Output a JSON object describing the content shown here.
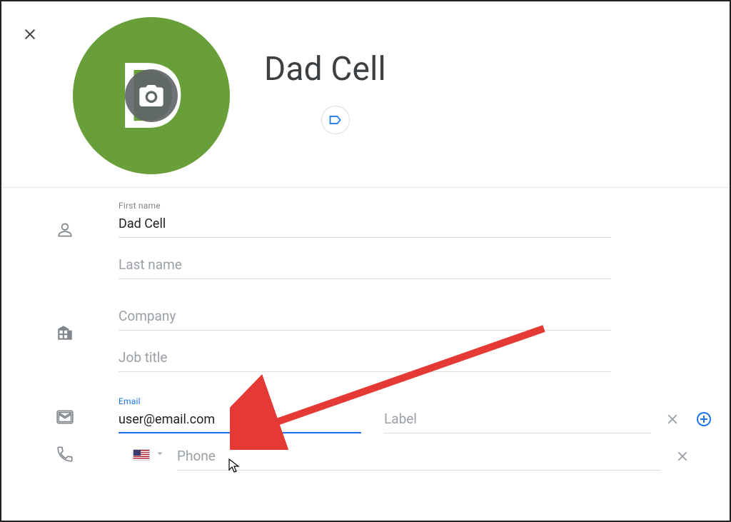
{
  "header": {
    "contact_title": "Dad Cell",
    "avatar_letter": "D"
  },
  "fields": {
    "first_name": {
      "label": "First name",
      "value": "Dad Cell"
    },
    "last_name": {
      "placeholder": "Last name",
      "value": ""
    },
    "company": {
      "placeholder": "Company",
      "value": ""
    },
    "job_title": {
      "placeholder": "Job title",
      "value": ""
    },
    "email": {
      "label": "Email",
      "value": "user@email.com"
    },
    "email_label": {
      "placeholder": "Label",
      "value": ""
    },
    "phone": {
      "placeholder": "Phone",
      "value": ""
    }
  }
}
